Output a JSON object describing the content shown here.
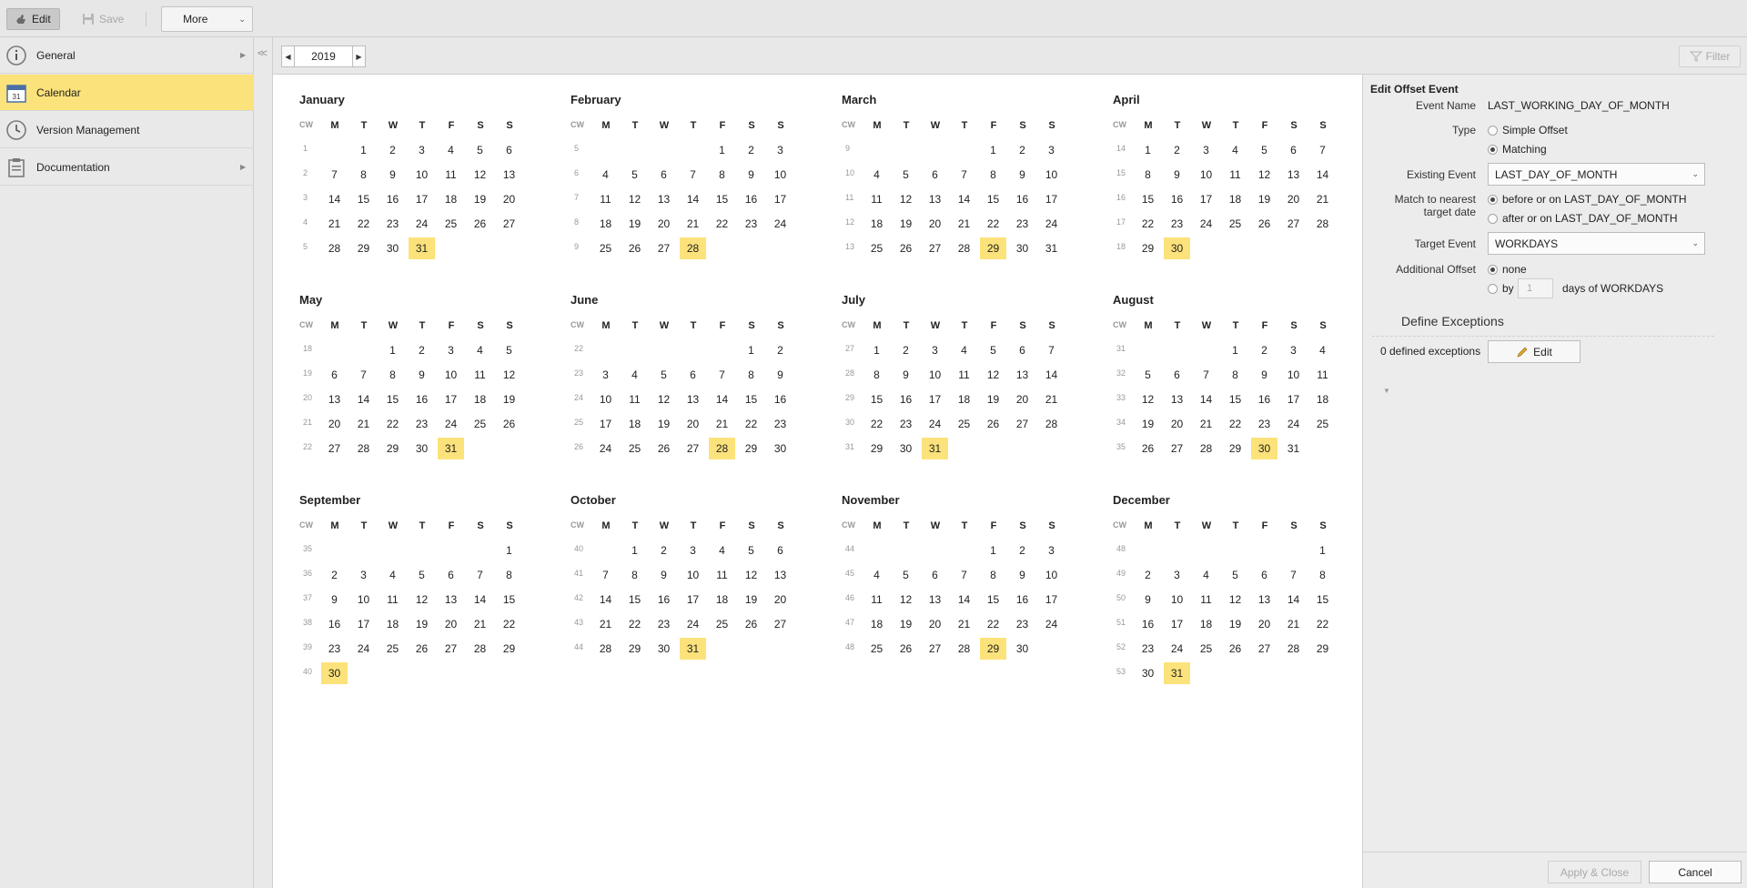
{
  "toolbar": {
    "edit_label": "Edit",
    "save_label": "Save",
    "more_label": "More"
  },
  "sidebar": {
    "items": [
      {
        "label": "General",
        "icon": "info-icon",
        "has_arrow": true
      },
      {
        "label": "Calendar",
        "icon": "calendar-icon",
        "has_arrow": false,
        "active": true
      },
      {
        "label": "Version Management",
        "icon": "clock-icon",
        "has_arrow": false
      },
      {
        "label": "Documentation",
        "icon": "clipboard-icon",
        "has_arrow": true
      }
    ]
  },
  "yearbar": {
    "year": "2019",
    "filter_label": "Filter"
  },
  "calendar": {
    "cw_label": "CW",
    "weekday_headers": [
      "M",
      "T",
      "W",
      "T",
      "F",
      "S",
      "S"
    ],
    "highlight_color": "#fce27a",
    "months": [
      {
        "name": "January",
        "first_weekday": 1,
        "days": 31,
        "cw_start": 1,
        "highlight": [
          31
        ]
      },
      {
        "name": "February",
        "first_weekday": 4,
        "days": 28,
        "cw_start": 5,
        "highlight": [
          28
        ]
      },
      {
        "name": "March",
        "first_weekday": 4,
        "days": 31,
        "cw_start": 9,
        "highlight": [
          29
        ]
      },
      {
        "name": "April",
        "first_weekday": 0,
        "days": 30,
        "cw_start": 14,
        "highlight": [
          30
        ]
      },
      {
        "name": "May",
        "first_weekday": 2,
        "days": 31,
        "cw_start": 18,
        "highlight": [
          31
        ]
      },
      {
        "name": "June",
        "first_weekday": 5,
        "days": 30,
        "cw_start": 22,
        "highlight": [
          28
        ]
      },
      {
        "name": "July",
        "first_weekday": 0,
        "days": 31,
        "cw_start": 27,
        "highlight": [
          31
        ]
      },
      {
        "name": "August",
        "first_weekday": 3,
        "days": 31,
        "cw_start": 31,
        "highlight": [
          30
        ]
      },
      {
        "name": "September",
        "first_weekday": 6,
        "days": 30,
        "cw_start": 35,
        "highlight": [
          30
        ]
      },
      {
        "name": "October",
        "first_weekday": 1,
        "days": 31,
        "cw_start": 40,
        "highlight": [
          31
        ]
      },
      {
        "name": "November",
        "first_weekday": 4,
        "days": 30,
        "cw_start": 44,
        "highlight": [
          29
        ]
      },
      {
        "name": "December",
        "first_weekday": 6,
        "days": 31,
        "cw_start": 48,
        "highlight": [
          31
        ],
        "cw_override": [
          48,
          49,
          50,
          51,
          52,
          53
        ]
      }
    ]
  },
  "panel": {
    "title": "Edit Offset Event",
    "event_name_label": "Event Name",
    "event_name_value": "LAST_WORKING_DAY_OF_MONTH",
    "type_label": "Type",
    "type_options": [
      "Simple Offset",
      "Matching"
    ],
    "type_selected": "Matching",
    "existing_event_label": "Existing Event",
    "existing_event_value": "LAST_DAY_OF_MONTH",
    "match_label_1": "Match to nearest",
    "match_label_2": "target date",
    "match_options": [
      "before or on LAST_DAY_OF_MONTH",
      "after or on LAST_DAY_OF_MONTH"
    ],
    "match_selected": "before or on LAST_DAY_OF_MONTH",
    "target_event_label": "Target Event",
    "target_event_value": "WORKDAYS",
    "additional_offset_label": "Additional Offset",
    "offset_none": "none",
    "offset_by": "by",
    "offset_days_value": "1",
    "offset_days_suffix": "days of WORKDAYS",
    "exceptions_title": "Define Exceptions",
    "exceptions_count": "0 defined exceptions",
    "exceptions_edit": "Edit",
    "apply_label": "Apply & Close",
    "cancel_label": "Cancel"
  }
}
